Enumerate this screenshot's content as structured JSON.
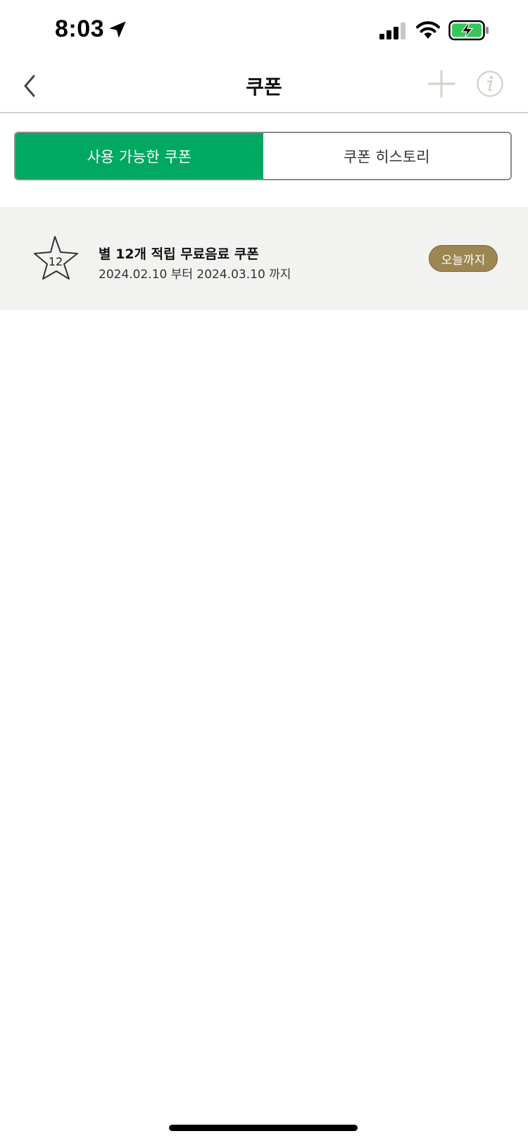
{
  "status_bar": {
    "time": "8:03",
    "icons": [
      "location-arrow-icon",
      "cellular-signal-icon",
      "wifi-icon",
      "battery-charging-icon"
    ],
    "battery_color": "#34c759"
  },
  "nav": {
    "title": "쿠폰",
    "back_icon": "chevron-left-icon",
    "add_icon": "plus-icon",
    "info_icon": "info-icon"
  },
  "tabs": [
    {
      "label": "사용 가능한 쿠폰",
      "active": true
    },
    {
      "label": "쿠폰 히스토리",
      "active": false
    }
  ],
  "coupons": [
    {
      "star_count": "12",
      "title": "별 12개 적립 무료음료 쿠폰",
      "period": "2024.02.10 부터 2024.03.10 까지",
      "badge": "오늘까지"
    }
  ],
  "colors": {
    "accent_green": "#00a862",
    "badge_gold": "#9c8652",
    "list_background": "#f2f2f0",
    "icon_muted": "#d6d0c6"
  }
}
